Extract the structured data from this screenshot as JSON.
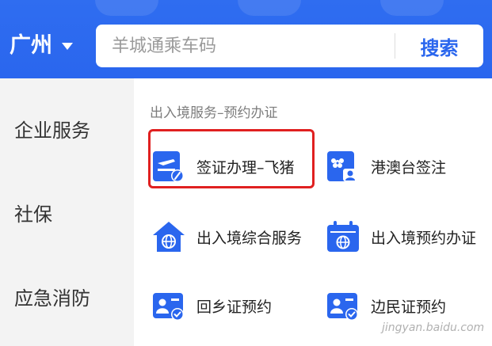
{
  "header": {
    "city": "广州",
    "search_placeholder": "羊城通乘车码",
    "search_button": "搜索"
  },
  "sidebar": {
    "items": [
      {
        "label": "企业服务"
      },
      {
        "label": "社保"
      },
      {
        "label": "应急消防"
      }
    ]
  },
  "section": {
    "title": "出入境服务–预约办证"
  },
  "services": [
    {
      "label": "签证办理–飞猪",
      "icon": "airplane-pen-icon"
    },
    {
      "label": "港澳台签注",
      "icon": "flower-id-icon"
    },
    {
      "label": "出入境综合服务",
      "icon": "house-globe-icon"
    },
    {
      "label": "出入境预约办证",
      "icon": "calendar-globe-icon"
    },
    {
      "label": "回乡证预约",
      "icon": "id-card-check-icon"
    },
    {
      "label": "边民证预约",
      "icon": "id-card-check-icon"
    }
  ],
  "watermark": "jingyan.baidu.com",
  "colors": {
    "header": "#2a66ee",
    "accent": "#2a66ee",
    "highlight": "#e02020",
    "sidebar_bg": "#f3f3f3"
  }
}
